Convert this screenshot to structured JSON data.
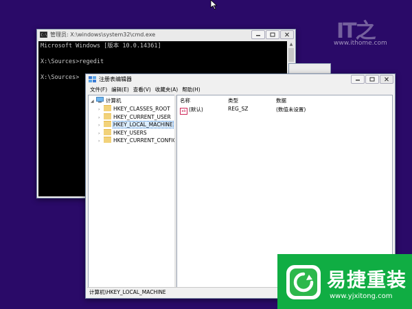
{
  "cmd_window": {
    "title": "管理员: X:\\windows\\system32\\cmd.exe",
    "lines": [
      "Microsoft Windows [版本 10.0.14361]",
      "",
      "X:\\Sources>regedit",
      "",
      "X:\\Sources>"
    ]
  },
  "regedit": {
    "title": "注册表编辑器",
    "menu": [
      "文件(F)",
      "编辑(E)",
      "查看(V)",
      "收藏夹(A)",
      "帮助(H)"
    ],
    "tree": {
      "root": "计算机",
      "keys": [
        "HKEY_CLASSES_ROOT",
        "HKEY_CURRENT_USER",
        "HKEY_LOCAL_MACHINE",
        "HKEY_USERS",
        "HKEY_CURRENT_CONFIG"
      ],
      "selected": "HKEY_LOCAL_MACHINE"
    },
    "columns": [
      "名称",
      "类型",
      "数据"
    ],
    "rows": [
      {
        "name": "(默认)",
        "type": "REG_SZ",
        "data": "(数值未设置)",
        "icon": "ab"
      }
    ],
    "status": "计算机\\HKEY_LOCAL_MACHINE"
  },
  "watermarks": {
    "ithome_url": "www.ithome.com",
    "yj_name": "易捷重装",
    "yj_url": "www.yjxitong.com"
  }
}
